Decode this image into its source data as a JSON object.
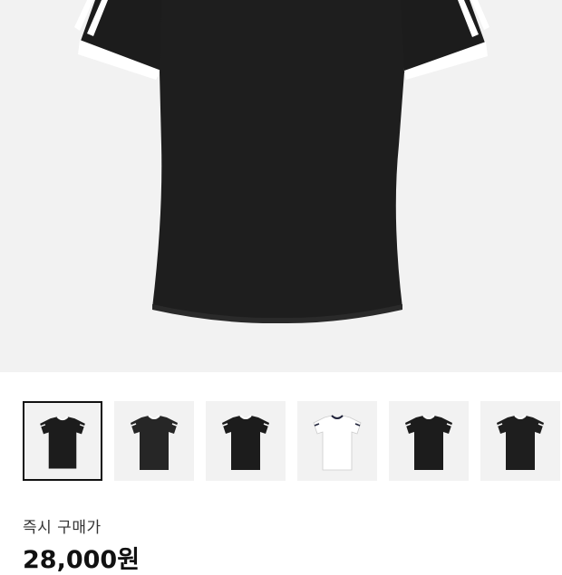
{
  "product": {
    "main_image": "black-three-stripe-fitted-tshirt",
    "selected_thumbnail": 0,
    "thumbnails": [
      {
        "name": "black-three-stripe-tee",
        "body": "#1c1c1c",
        "trim": "#ffffff"
      },
      {
        "name": "black-trefoil-pinstripe-tee",
        "body": "#262626",
        "trim": "#ffffff"
      },
      {
        "name": "black-cropped-tee",
        "body": "#1c1c1c",
        "trim": "#ffffff"
      },
      {
        "name": "white-ringer-tee",
        "body": "#ffffff",
        "trim": "#20233a"
      },
      {
        "name": "black-slim-trefoil-tee",
        "body": "#1c1c1c",
        "trim": "#ffffff"
      },
      {
        "name": "black-three-stripe-tee-alt",
        "body": "#1e1e1e",
        "trim": "#ffffff"
      }
    ]
  },
  "purchase": {
    "label": "즉시 구매가",
    "price": "28,000원"
  }
}
